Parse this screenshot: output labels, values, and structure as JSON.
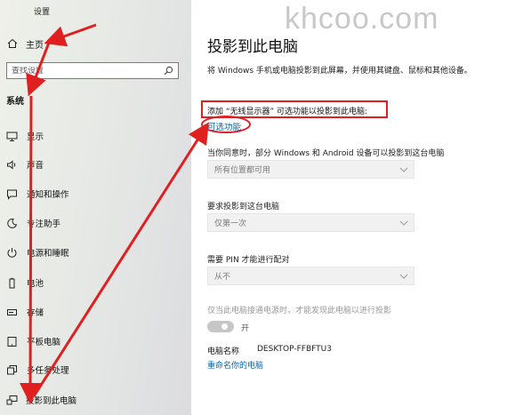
{
  "window": {
    "title": "设置"
  },
  "watermark": "khcoo.com",
  "sidebar": {
    "home_label": "主页",
    "search_placeholder": "查找设置",
    "section_label": "系统",
    "items": [
      {
        "label": "显示",
        "icon": "monitor-icon"
      },
      {
        "label": "声音",
        "icon": "speaker-icon"
      },
      {
        "label": "通知和操作",
        "icon": "notification-icon"
      },
      {
        "label": "专注助手",
        "icon": "moon-icon"
      },
      {
        "label": "电源和睡眠",
        "icon": "power-icon"
      },
      {
        "label": "电池",
        "icon": "battery-icon"
      },
      {
        "label": "存储",
        "icon": "storage-icon"
      },
      {
        "label": "平板电脑",
        "icon": "tablet-icon"
      },
      {
        "label": "多任务处理",
        "icon": "multitask-icon"
      },
      {
        "label": "投影到此电脑",
        "icon": "project-icon",
        "active": true
      }
    ]
  },
  "main": {
    "title": "投影到此电脑",
    "description": "将 Windows 手机或电脑投影到此屏幕，并使用其键盘、鼠标和其他设备。",
    "add_display_label": "添加 “无线显示器” 可选功能以投影到此电脑:",
    "optional_features_link": "可选功能",
    "allow_label": "当你同意时，部分 Windows 和 Android 设备可以投影到这台电脑",
    "allow_value": "所有位置都可用",
    "ask_label": "要求投影到这台电脑",
    "ask_value": "仅第一次",
    "pin_label": "需要 PIN 才能进行配对",
    "pin_value": "从不",
    "power_checkbox_label": "仅当此电脑接通电源时，才能发现此电脑以进行投影",
    "toggle_label": "开",
    "pc_name_label": "电脑名称",
    "pc_name_value": "DESKTOP-FFBFTU3",
    "rename_link": "重命名你的电脑"
  },
  "colors": {
    "accent": "#0063b1",
    "annotation": "#e02020"
  }
}
